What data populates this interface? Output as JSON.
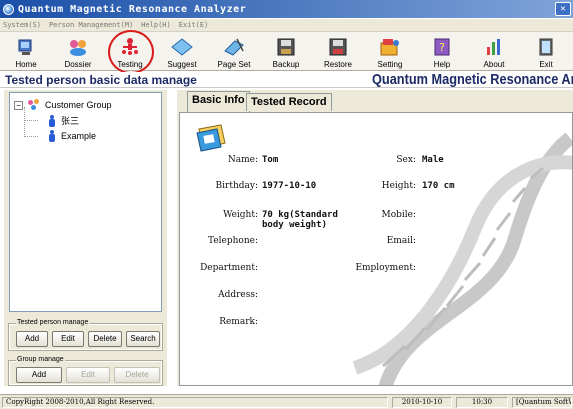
{
  "window": {
    "title": "Quantum Magnetic Resonance Analyzer"
  },
  "menu": [
    "System(S)",
    "Person Management(M)",
    "Help(H)",
    "Exit(E)"
  ],
  "toolbar": [
    {
      "name": "home",
      "label": "Home",
      "icon": "home-icon"
    },
    {
      "name": "dossier",
      "label": "Dossier",
      "icon": "dossier-icon"
    },
    {
      "name": "testing",
      "label": "Testing",
      "icon": "testing-icon"
    },
    {
      "name": "suggest",
      "label": "Suggest",
      "icon": "suggest-icon"
    },
    {
      "name": "page-set",
      "label": "Page Set",
      "icon": "page-set-icon"
    },
    {
      "name": "backup",
      "label": "Backup",
      "icon": "backup-icon"
    },
    {
      "name": "restore",
      "label": "Restore",
      "icon": "restore-icon"
    },
    {
      "name": "setting",
      "label": "Setting",
      "icon": "setting-icon"
    },
    {
      "name": "help",
      "label": "Help",
      "icon": "help-icon"
    },
    {
      "name": "about",
      "label": "About",
      "icon": "about-icon"
    },
    {
      "name": "exit",
      "label": "Exit",
      "icon": "exit-icon"
    }
  ],
  "header": {
    "page_title": "Tested person basic data manage",
    "brand": "Quantum Magnetic Resonance Anal"
  },
  "tree": {
    "root": "Customer Group",
    "children": [
      "张三",
      "Example"
    ]
  },
  "tested_person_manage": {
    "legend": "Tested person manage",
    "buttons": [
      "Add",
      "Edit",
      "Delete",
      "Search"
    ]
  },
  "group_manage": {
    "legend": "Group manage",
    "buttons": [
      "Add",
      "Edit",
      "Delete"
    ]
  },
  "tabs": [
    "Basic Info",
    "Tested Record"
  ],
  "basic_info": {
    "name_label": "Name:",
    "name_value": "Tom",
    "sex_label": "Sex:",
    "sex_value": "Male",
    "birthday_label": "Birthday:",
    "birthday_value": "1977-10-10",
    "height_label": "Height:",
    "height_value": "170 cm",
    "weight_label": "Weight:",
    "weight_value_line1": "70 kg(Standard",
    "weight_value_line2": "body weight)",
    "mobile_label": "Mobile:",
    "telephone_label": "Telephone:",
    "email_label": "Email:",
    "department_label": "Department:",
    "employment_label": "Employment:",
    "address_label": "Address:",
    "remark_label": "Remark:"
  },
  "status": {
    "copyright": "CopyRight 2008-2010,All Right Reserved.",
    "date": "2010-10-10",
    "time": "10:30",
    "company": "[Quantum SoftW"
  },
  "colors": {
    "title_gradient_start": "#1a4fa8",
    "heading_text": "#1c2a66",
    "highlight_circle": "#d81b1b"
  }
}
